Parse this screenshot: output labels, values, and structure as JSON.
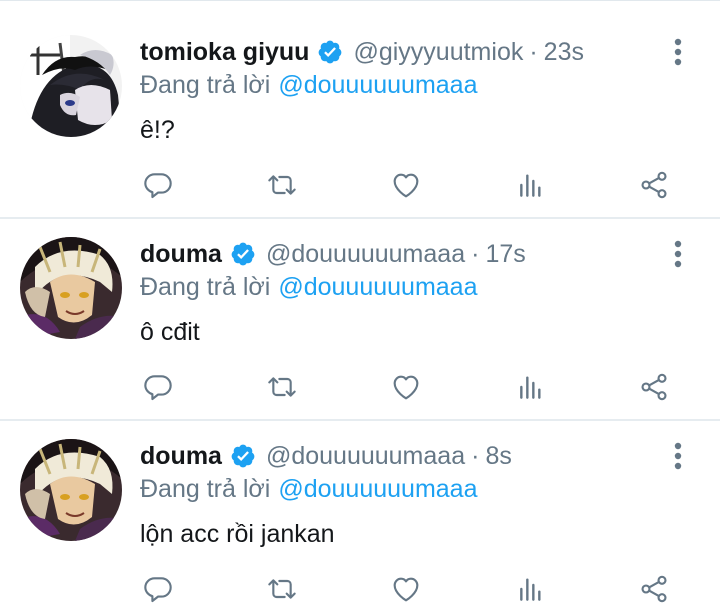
{
  "tweets": [
    {
      "name": "tomioka giyuu",
      "handle": "@giyyyuutmiok",
      "separator": "·",
      "time": "23s",
      "reply_prefix": "Đang trả lời",
      "reply_to": "@douuuuuumaaa",
      "text": "ê!?"
    },
    {
      "name": "douma",
      "handle": "@douuuuuumaaa",
      "separator": "·",
      "time": "17s",
      "reply_prefix": "Đang trả lời",
      "reply_to": "@douuuuuumaaa",
      "text": "ô cđit"
    },
    {
      "name": "douma",
      "handle": "@douuuuuumaaa",
      "separator": "·",
      "time": "8s",
      "reply_prefix": "Đang trả lời",
      "reply_to": "@douuuuuumaaa",
      "text": "lộn acc rồi jankan"
    }
  ],
  "colors": {
    "verified": "#1da1f2",
    "mention": "#1da1f2",
    "secondary_text": "#657786",
    "icon": "#657786"
  },
  "icons": [
    "more-vertical-icon",
    "reply-icon",
    "retweet-icon",
    "like-icon",
    "analytics-icon",
    "share-icon",
    "verified-icon"
  ]
}
